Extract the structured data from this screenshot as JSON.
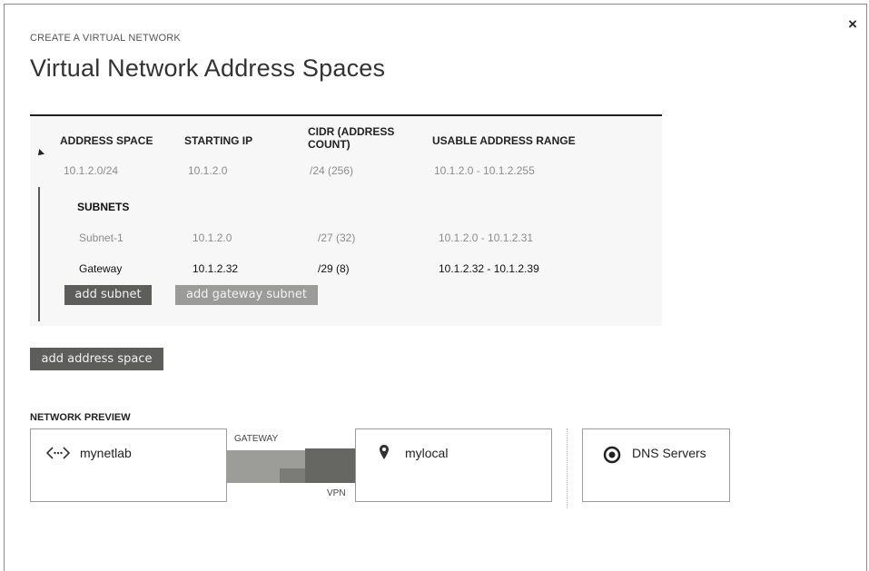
{
  "wizard": {
    "step_label": "CREATE A VIRTUAL NETWORK",
    "title": "Virtual Network Address Spaces",
    "close_glyph": "×"
  },
  "address_space": {
    "columns": [
      "ADDRESS SPACE",
      "STARTING IP",
      "CIDR (ADDRESS\nCOUNT)",
      "USABLE ADDRESS RANGE"
    ],
    "row": {
      "address_space": "10.1.2.0/24",
      "starting_ip": "10.1.2.0",
      "cidr": "/24 (256)",
      "usable_range": "10.1.2.0 - 10.1.2.255"
    },
    "subnets_header": "SUBNETS",
    "subnets": [
      {
        "name": "Subnet-1",
        "starting_ip": "10.1.2.0",
        "cidr": "/27 (32)",
        "usable_range": "10.1.2.0 - 10.1.2.31"
      },
      {
        "name": "Gateway",
        "starting_ip": "10.1.2.32",
        "cidr": "/29 (8)",
        "usable_range": "10.1.2.32 - 10.1.2.39"
      }
    ],
    "add_subnet_label": "add subnet",
    "add_gateway_subnet_label": "add gateway subnet"
  },
  "add_address_space_label": "add address space",
  "network_preview": {
    "label": "NETWORK PREVIEW",
    "virtual_network": "mynetlab",
    "gateway_label": "GATEWAY",
    "vpn_label": "VPN",
    "local_network": "mylocal",
    "dns": "DNS Servers"
  },
  "icons": {
    "virtual_network": "network-brackets-icon",
    "local_network": "location-pin-icon",
    "dns": "dns-target-icon",
    "expand": "expand-triangle-icon"
  }
}
